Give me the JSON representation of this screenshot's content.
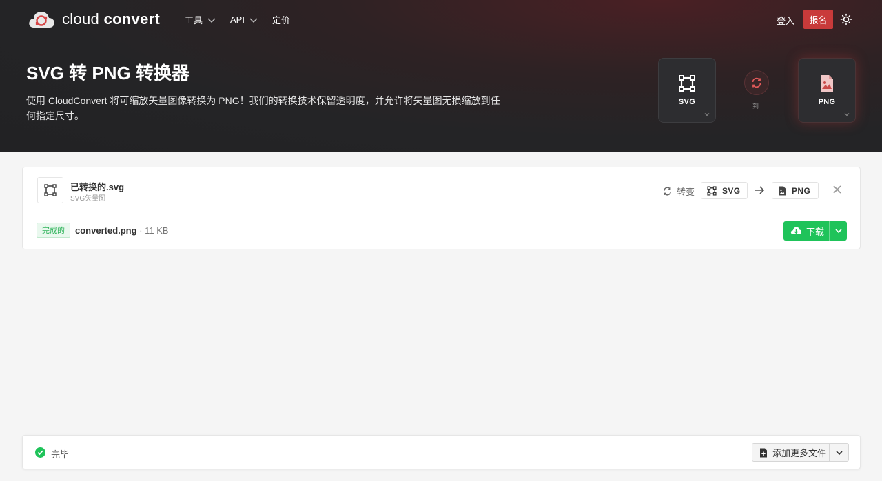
{
  "brand": {
    "name_light": "cloud",
    "name_bold": "convert",
    "accent": "#c93a3a"
  },
  "nav": {
    "items": [
      {
        "label": "工具",
        "has_dropdown": true
      },
      {
        "label": "API",
        "has_dropdown": true
      },
      {
        "label": "定价",
        "has_dropdown": false
      }
    ],
    "login": "登入",
    "signup": "报名",
    "theme_icon": "sun-icon"
  },
  "hero": {
    "title": "SVG 转 PNG 转换器",
    "description": "使用 CloudConvert 将可缩放矢量图像转换为 PNG！我们的转换技术保留透明度，并允许将矢量图无损缩放到任何指定尺寸。",
    "from_format": "SVG",
    "to_format": "PNG",
    "to_word": "到"
  },
  "file": {
    "name": "已转换的.svg",
    "type": "SVG矢量图",
    "convert_label": "转变",
    "from_format": "SVG",
    "to_format": "PNG",
    "status": "完成的",
    "output_name": "converted.png",
    "output_size": "· 11 KB",
    "download_label": "下载",
    "status_color": "#1fc35a"
  },
  "footer": {
    "status": "完毕",
    "add_more_label": "添加更多文件"
  }
}
